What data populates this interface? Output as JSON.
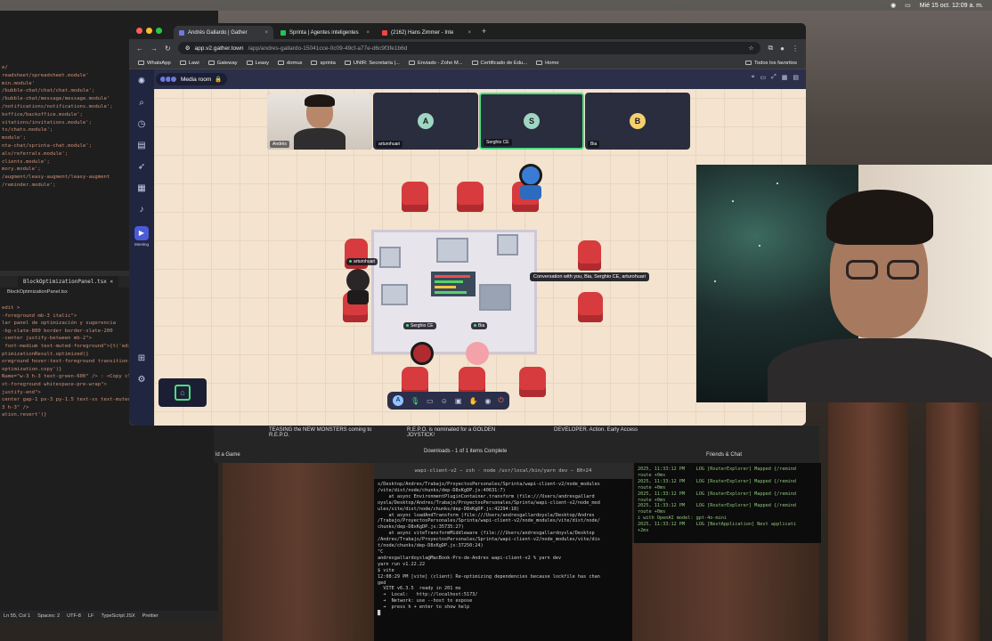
{
  "menubar": {
    "datetime": "Mié 15 oct. 12:09 a. m."
  },
  "editor": {
    "top_lines": [
      "e/",
      "readsheet/spreadsheet.module'",
      "min.module'",
      "/bubble-chat/chat/chat.module';",
      "/bubble-chat/message/message.module'",
      "/notifications/notifications.module';",
      "koffice/backoffice.module';",
      "vitations/invitations.module';",
      "ts/chats.module';",
      "module';",
      "nta-chat/sprinta-chat.module';",
      "als/referrals.module';",
      "clients.module';",
      "mory.module';",
      "/augment/leasy-augment/leasy-augment",
      "/reminder.module';"
    ],
    "tab_label": "BlockOptimizationPanel.tsx",
    "breadcrumb": "BlockOptimizationPanel.tsx",
    "bottom_lines": [
      "edit >",
      "",
      "",
      "",
      "",
      "",
      "",
      "-foreground mb-3 italic\">",
      "",
      "",
      "",
      "",
      "lar panel de optimización y sugerencia",
      "",
      "",
      "",
      "",
      "",
      "",
      "-bg-slate-800 border border-slate-200",
      "-center justify-between mb-2\">",
      " font-medium text-muted-foreground\">{t('edit.edito",
      "",
      "ptimizationResult.optimized)}",
      "oreground hover:text-foreground transition-colors",
      "optimization.copy')}",
      "",
      "Name=\"w-3 h-3 text-green-600\" /> : <Copy className",
      "",
      "",
      "",
      "xt-foreground whitespace-pre-wrap\">",
      "",
      "",
      "",
      "justify-end\">",
      "",
      "",
      "",
      "center gap-1 px-3 py-1.5 text-xs text-muted-foregrou",
      "",
      "3 h-3\" />",
      "ation.revert')}"
    ],
    "status": [
      "Ln 55, Col 1",
      "Spaces: 2",
      "UTF-8",
      "LF",
      "TypeScript JSX",
      "Prettier"
    ]
  },
  "browser": {
    "tabs": [
      {
        "label": "Andrés Gallardo | Gather",
        "color": "#6c7ae0",
        "active": true
      },
      {
        "label": "Sprinta | Agentes inteligentes",
        "color": "#22c55e",
        "active": false
      },
      {
        "label": "(2162) Hans Zimmer - Inte",
        "color": "#ef4444",
        "active": false
      }
    ],
    "url_host": "app.v2.gather.town",
    "url_path": "/app/andres-gallardo-15041cce-0c09-49cf-a77e-d6c9f3fe1b6d",
    "bookmarks": [
      "WhatsApp",
      "Lawi",
      "Gateway",
      "Leasy",
      "domus",
      "sprinta",
      "UNIR: Secretaría |...",
      "Enviado - Zoho M...",
      "Certificado de Edu...",
      "Home"
    ],
    "bookmarks_right": "Todos los favoritos"
  },
  "gather": {
    "room_name": "Media room",
    "tiles": [
      {
        "name": "Andrés",
        "initial": "",
        "color": "#2a2d3e"
      },
      {
        "name": "arturohuari",
        "initial": "A",
        "color": "#9fd6c2"
      },
      {
        "name": "Serghio CE",
        "initial": "S",
        "color": "#9fd6c2"
      },
      {
        "name": "Bia",
        "initial": "B",
        "color": "#f4d06f"
      }
    ],
    "nametags": {
      "arturohuari": "arturohuari",
      "serghio": "Serghio CE",
      "bia": "Bia"
    },
    "conversation": "Conversation with you, Bia, Serghio CE, arturohuari",
    "me_initial": "A"
  },
  "below": {
    "thumb1": "TEASING the NEW MONSTERS coming to R.E.P.O.",
    "thumb2": "R.E.P.O. is nominated for a GOLDEN JOYSTICK!",
    "thumb3": "DEVELOPER. Action. Early Access",
    "downloads": "Downloads - 1 of 1 items Complete",
    "add_game": "ld a Game",
    "friends": "Friends & Chat"
  },
  "terminal": {
    "title": "wapi-client-v2 — zsh · node /usr/local/bin/yarn dev — 80×24",
    "lines": [
      "s/Desktop/Andres/Trabajo/ProyectosPersonales/Sprinta/wapi-client-v2/node_modules",
      "/vite/dist/node/chunks/dep-D8xKgDP.js:40631:7)",
      "    at async EnvironmentPluginContainer.transform (file:///Users/andresgallard",
      "oysla/Desktop/Andres/Trabajo/ProyectosPersonales/Sprinta/wapi-client-v2/node_mod",
      "ules/vite/dist/node/chunks/dep-D8xKgDP.js:42294:18)",
      "    at async loadAndTransform (file:///Users/andresgallardoysla/Desktop/Andres",
      "/Trabajo/ProyectosPersonales/Sprinta/wapi-client-v2/node_modules/vite/dist/node/",
      "chunks/dep-D8xKgDP.js:35735:27)",
      "    at async viteTransformMiddleware (file:///Users/andresgallardoysla/Desktop",
      "/Andres/Trabajo/ProyectosPersonales/Sprinta/wapi-client-v2/node_modules/vite/dis",
      "t/node/chunks/dep-D8xKgDP.js:37250:24)",
      "^C",
      "andresgallardoysla@MacBook-Pro-de-Andres wapi-client-v2 % yarn dev",
      "yarn run v1.22.22",
      "$ vite",
      "12:08:29 PM [vite] (client) Re-optimizing dependencies because lockfile has chan",
      "ged",
      "",
      "  VITE v6.3.5  ready in 201 ms",
      "",
      "  ➜  Local:   http://localhost:5173/",
      "  ➜  Network: use --host to expose",
      "  ➜  press h + enter to show help",
      "█"
    ]
  },
  "terminal2": {
    "lines": [
      "2025, 11:33:12 PM    LOG [RouterExplorer] Mapped {/remind",
      "route +0ms",
      "2025, 11:33:12 PM    LOG [RouterExplorer] Mapped {/remind",
      "route +0ms",
      "2025, 11:33:12 PM    LOG [RouterExplorer] Mapped {/remind",
      "route +0ms",
      "2025, 11:33:12 PM    LOG [RouterExplorer] Mapped {/remind",
      "route +0ms",
      "i with OpenAI model: gpt-4o-mini",
      "2025, 11:33:12 PM    LOG [NestApplication] Nest applicati",
      "+2ms"
    ]
  }
}
